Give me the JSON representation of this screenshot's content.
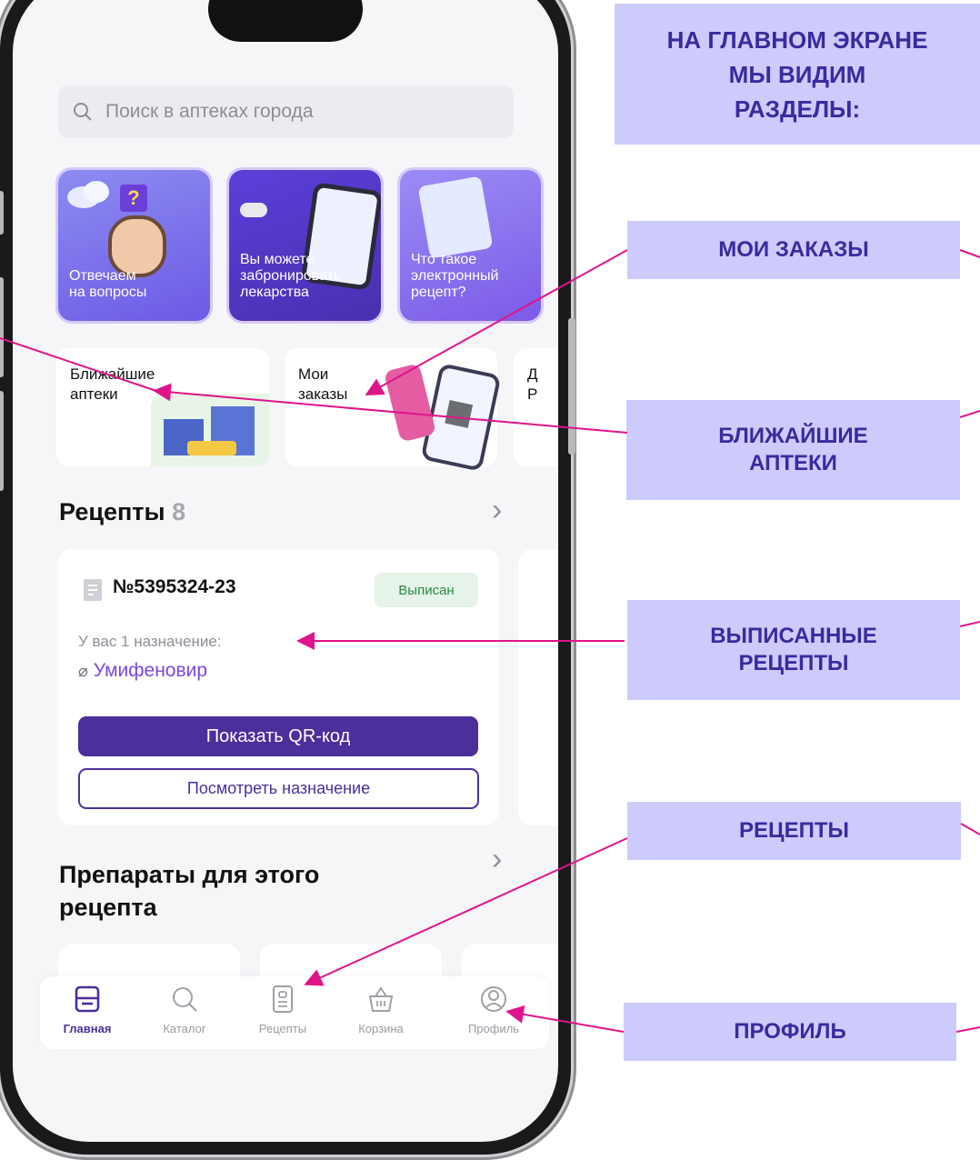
{
  "search": {
    "placeholder": "Поиск в аптеках города"
  },
  "stories": [
    {
      "text": "Отвечаем на вопросы",
      "line1": "Отвечаем",
      "line2": "на вопросы"
    },
    {
      "text": "Вы можете забронировать лекарства",
      "line1": "Вы можете",
      "line2": "забронировать",
      "line3": "лекарства"
    },
    {
      "text": "Что такое электронный рецепт?",
      "line1": "Что такое",
      "line2": "электронный",
      "line3": "рецепт?"
    }
  ],
  "quick": [
    {
      "line1": "Ближайшие",
      "line2": "аптеки"
    },
    {
      "line1": "Мои",
      "line2": "заказы"
    },
    {
      "line1": "Д",
      "line2": "Р"
    }
  ],
  "recipes": {
    "title": "Рецепты",
    "count": "8",
    "card": {
      "number": "№5395324-23",
      "status": "Выписан",
      "assignments": "У вас 1 назначение:",
      "drug": "Умифеновир",
      "show_qr": "Показать QR-код",
      "view_assignment": "Посмотреть назначение"
    }
  },
  "products": {
    "title": "Препараты для этого рецепта"
  },
  "tabbar": [
    {
      "label": "Главная",
      "icon": "home-icon",
      "active": true
    },
    {
      "label": "Каталог",
      "icon": "search-icon",
      "active": false
    },
    {
      "label": "Рецепты",
      "icon": "document-icon",
      "active": false
    },
    {
      "label": "Корзина",
      "icon": "basket-icon",
      "active": false
    },
    {
      "label": "Профиль",
      "icon": "profile-icon",
      "active": false
    }
  ],
  "callouts": {
    "header": "НА ГЛАВНОМ ЭКРАНЕ МЫ ВИДИМ РАЗДЕЛЫ:",
    "header_l1": "НА ГЛАВНОМ ЭКРАНЕ",
    "header_l2": "МЫ ВИДИМ",
    "header_l3": "РАЗДЕЛЫ:",
    "orders": "МОИ ЗАКАЗЫ",
    "pharmacies_l1": "БЛИЖАЙШИЕ",
    "pharmacies_l2": "АПТЕКИ",
    "issued_l1": "ВЫПИСАННЫЕ",
    "issued_l2": "РЕЦЕПТЫ",
    "recipes": "РЕЦЕПТЫ",
    "profile": "ПРОФИЛЬ"
  },
  "colors": {
    "accent": "#4b2f9a",
    "callout_bg": "#cccbfb",
    "callout_text": "#3a2a9e",
    "arrow": "#e0148a",
    "drug": "#7c48df",
    "badge_bg": "#e5f3e8",
    "badge_text": "#2d8a47"
  }
}
